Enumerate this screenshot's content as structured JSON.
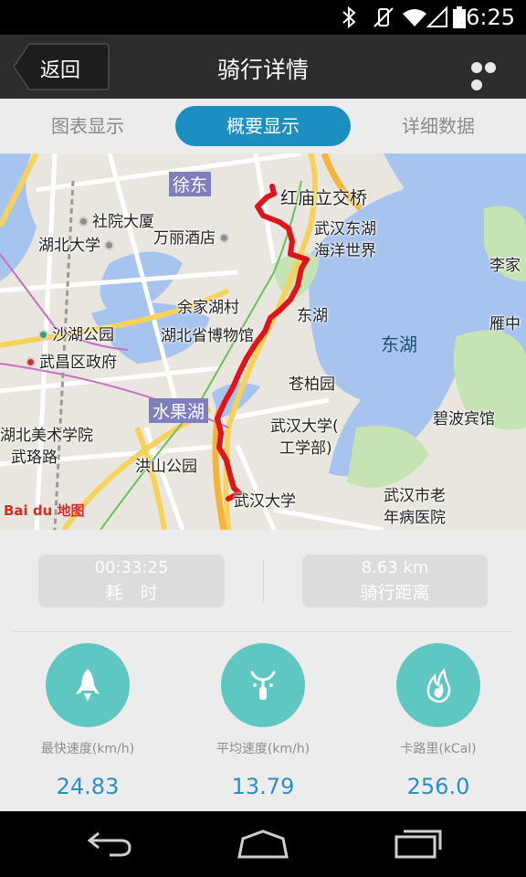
{
  "status_bar": {
    "time": "6:25"
  },
  "header": {
    "back_label": "返回",
    "title": "骑行详情"
  },
  "tabs": [
    {
      "label": "图表显示",
      "active": false
    },
    {
      "label": "概要显示",
      "active": true
    },
    {
      "label": "详细数据",
      "active": false
    }
  ],
  "map": {
    "labels": {
      "xudong": "徐东",
      "hongmiao": "红庙立交桥",
      "shyuan": "社院大厦",
      "hubei_u": "湖北大学",
      "wanli": "万丽酒店",
      "whdh_1": "武汉东湖",
      "whdh_2": "海洋世界",
      "lijia": "李家",
      "yuanzhong": "雁中",
      "yujiahu": "余家湖村",
      "museum": "湖北省博物馆",
      "donghu_poi": "东湖",
      "donghu_lake": "东湖",
      "shahu": "沙湖公园",
      "wuchang": "武昌区政府",
      "cangbai": "苍柏园",
      "shuiguohu": "水果湖",
      "meishu": "湖北美术学院",
      "wuluo": "武珞路",
      "whu_gb_1": "武汉大学(",
      "whu_gb_2": "工学部)",
      "bibo": "碧波宾馆",
      "hongshan": "洪山公园",
      "whu": "武汉大学",
      "shilao_1": "武汉市老",
      "shilao_2": "年病医院",
      "baidu": "Bai du 地图"
    }
  },
  "summary": {
    "duration": {
      "value": "00:33:25",
      "label": "耗　时"
    },
    "distance": {
      "value": "8.63 km",
      "label": "骑行距离"
    },
    "metrics": [
      {
        "icon": "rocket-icon",
        "label": "最快速度(km/h)",
        "value": "24.83"
      },
      {
        "icon": "bicycle-icon",
        "label": "平均速度(km/h)",
        "value": "13.79"
      },
      {
        "icon": "flame-icon",
        "label": "卡路里(kCal)",
        "value": "256.0"
      }
    ]
  },
  "colors": {
    "accent": "#1d8ec0",
    "metric_circle": "#5ec7c1",
    "metric_value": "#2d8fbf",
    "route": "#e0141b"
  }
}
